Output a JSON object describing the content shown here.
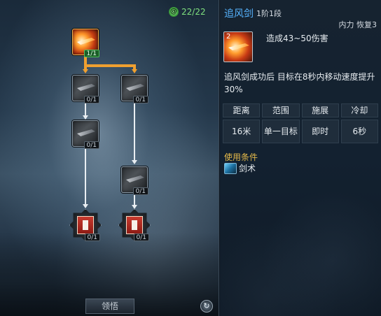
{
  "tree": {
    "points": "22/22",
    "points_icon": "green-spiral-icon",
    "nodes": [
      {
        "id": "root",
        "badge": "1/1",
        "learned": true
      },
      {
        "id": "left-1",
        "badge": "0/1"
      },
      {
        "id": "right-1",
        "badge": "0/1"
      },
      {
        "id": "left-2",
        "badge": "0/1"
      },
      {
        "id": "right-2",
        "badge": "0/1"
      },
      {
        "id": "left-3",
        "badge": "0/1"
      },
      {
        "id": "right-3",
        "badge": "0/1"
      }
    ],
    "learn_label": "领悟",
    "reset_icon": "reset-icon"
  },
  "info": {
    "skill_name": "追风剑",
    "stage": "1阶1段",
    "resource": "内力 恢复3",
    "icon_level": "2",
    "damage": "造成43~50伤害",
    "description": "追风剑成功后 目标在8秒内移动速度提升30%",
    "stats": {
      "headers": [
        "距离",
        "范围",
        "施展",
        "冷却"
      ],
      "values": [
        "16米",
        "单一目标",
        "即时",
        "6秒"
      ]
    },
    "condition_title": "使用条件",
    "condition_item": "剑术"
  },
  "colors": {
    "accent_blue": "#56b4ff",
    "condition_gold": "#e4b94a",
    "active_connector": "#f0a030",
    "points_green": "#7fe07f"
  }
}
